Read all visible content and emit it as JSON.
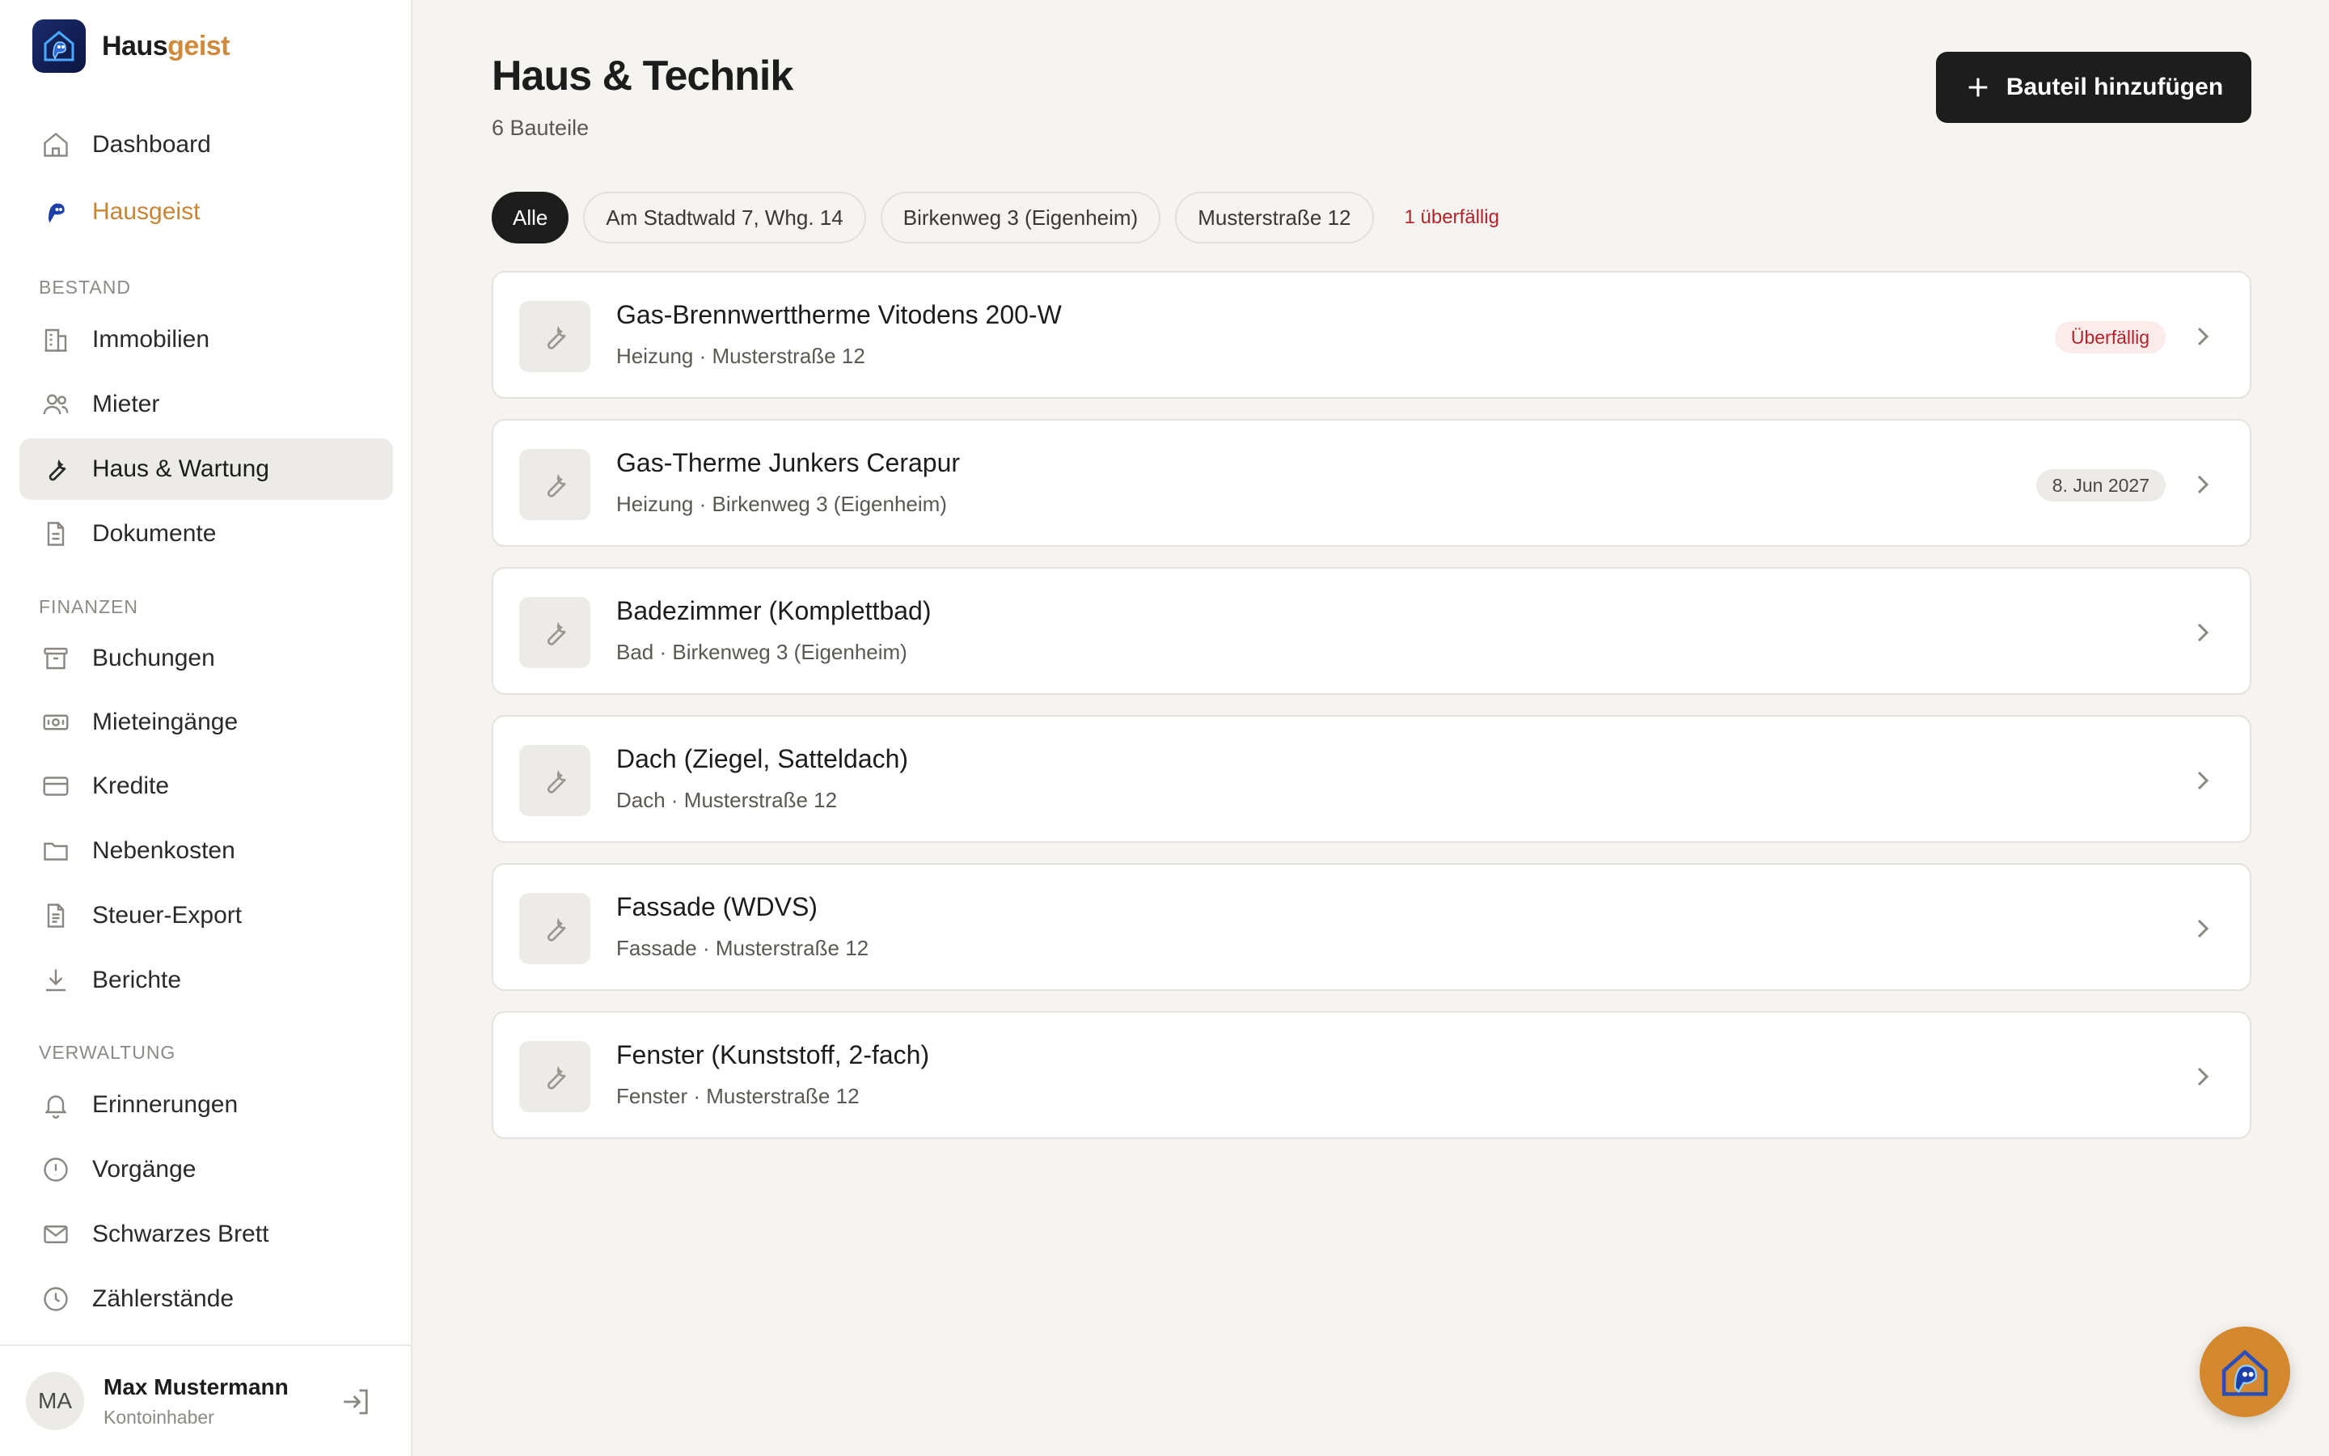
{
  "brand": {
    "name_main": "Haus",
    "name_accent": "geist",
    "accent_color": "#d08a3c"
  },
  "sidebar": {
    "top_items": [
      {
        "label": "Dashboard",
        "icon": "home-icon"
      },
      {
        "label": "Hausgeist",
        "icon": "hausgeist-icon"
      }
    ],
    "sections": [
      {
        "label": "BESTAND",
        "items": [
          {
            "label": "Immobilien",
            "icon": "building-icon"
          },
          {
            "label": "Mieter",
            "icon": "users-icon"
          },
          {
            "label": "Haus & Wartung",
            "icon": "wrench-icon",
            "active": true
          },
          {
            "label": "Dokumente",
            "icon": "document-icon"
          }
        ]
      },
      {
        "label": "FINANZEN",
        "items": [
          {
            "label": "Buchungen",
            "icon": "archive-icon"
          },
          {
            "label": "Mieteingänge",
            "icon": "banknote-icon"
          },
          {
            "label": "Kredite",
            "icon": "credit-card-icon"
          },
          {
            "label": "Nebenkosten",
            "icon": "folder-icon"
          },
          {
            "label": "Steuer-Export",
            "icon": "file-text-icon"
          },
          {
            "label": "Berichte",
            "icon": "download-icon"
          }
        ]
      },
      {
        "label": "VERWALTUNG",
        "items": [
          {
            "label": "Erinnerungen",
            "icon": "bell-icon"
          },
          {
            "label": "Vorgänge",
            "icon": "alert-circle-icon"
          },
          {
            "label": "Schwarzes Brett",
            "icon": "mail-icon"
          },
          {
            "label": "Zählerstände",
            "icon": "clock-icon"
          }
        ]
      }
    ]
  },
  "user": {
    "initials": "MA",
    "name": "Max Mustermann",
    "role": "Kontoinhaber"
  },
  "header": {
    "title": "Haus & Technik",
    "subtitle": "6 Bauteile",
    "add_button": "Bauteil hinzufügen"
  },
  "filters": {
    "chips": [
      "Alle",
      "Am Stadtwald 7, Whg. 14",
      "Birkenweg 3 (Eigenheim)",
      "Musterstraße 12"
    ],
    "active": "Alle",
    "overdue_label": "1 überfällig",
    "overdue_color": "#b4232a"
  },
  "components": [
    {
      "title": "Gas-Brennwerttherme Vitodens 200-W",
      "meta": "Heizung · Musterstraße 12",
      "badge": "Überfällig",
      "badge_type": "overdue"
    },
    {
      "title": "Gas-Therme Junkers Cerapur",
      "meta": "Heizung · Birkenweg 3 (Eigenheim)",
      "badge": "8. Jun 2027",
      "badge_type": "date"
    },
    {
      "title": "Badezimmer (Komplettbad)",
      "meta": "Bad · Birkenweg 3 (Eigenheim)",
      "badge": "",
      "badge_type": ""
    },
    {
      "title": "Dach (Ziegel, Satteldach)",
      "meta": "Dach · Musterstraße 12",
      "badge": "",
      "badge_type": ""
    },
    {
      "title": "Fassade (WDVS)",
      "meta": "Fassade · Musterstraße 12",
      "badge": "",
      "badge_type": ""
    },
    {
      "title": "Fenster (Kunststoff, 2-fach)",
      "meta": "Fenster · Musterstraße 12",
      "badge": "",
      "badge_type": ""
    }
  ]
}
